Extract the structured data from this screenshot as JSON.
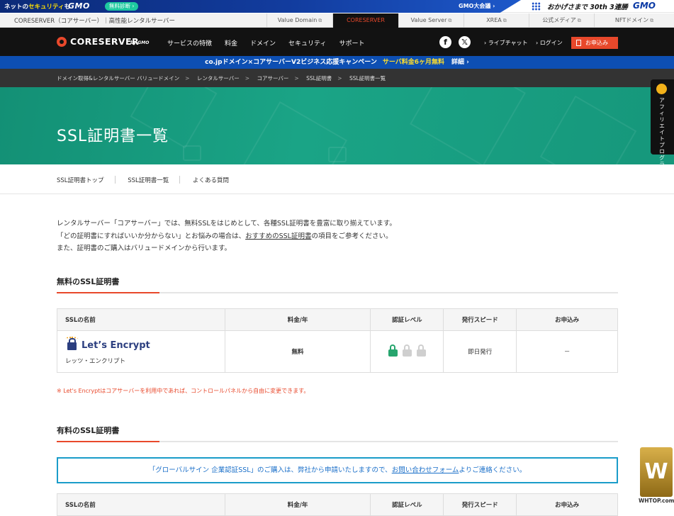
{
  "gmo_banner": {
    "text_prefix": "ネットの",
    "text_highlight": "セキュリティ",
    "text_suffix": "も",
    "logo": "GMO",
    "diagnosis_button": "無料診断 ›",
    "meeting_link": "GMO大会議 ›",
    "okage": "おかげさまで 30th 3連勝",
    "logo_right": "GMO"
  },
  "service_nav": {
    "brand": "CORESERVER（コアサーバー）｜高性能レンタルサーバー",
    "tabs": [
      {
        "label": "Value Domain",
        "ext": "⧉"
      },
      {
        "label": "CORESERVER",
        "ext": ""
      },
      {
        "label": "Value Server",
        "ext": "⧉"
      },
      {
        "label": "XREA",
        "ext": "⧉"
      },
      {
        "label": "公式メディア",
        "ext": "⧉"
      },
      {
        "label": "NFTドメイン",
        "ext": "⧉"
      }
    ]
  },
  "header": {
    "logo_text": "CORESERVER",
    "logo_by": "by GMO",
    "nav": [
      "サービスの特徴",
      "料金",
      "ドメイン",
      "セキュリティ",
      "サポート"
    ],
    "live_chat": "› ライブチャット",
    "login": "› ログイン",
    "apply": "お申込み"
  },
  "campaign": {
    "main": "co.jpドメイン×コアサーバーV2ビジネス応援キャンペーン",
    "highlight": "サーバ料金6ヶ月無料",
    "more": "詳細 ›"
  },
  "breadcrumb": [
    "ドメイン取得&レンタルサーバー バリュードメイン",
    "レンタルサーバー",
    "コアサーバー",
    "SSL証明書",
    "SSL証明書一覧"
  ],
  "hero": {
    "title": "SSL証明書一覧"
  },
  "affiliate": {
    "label": "アフィリエイトプログラム開始 ›"
  },
  "subnav": [
    "SSL証明書トップ",
    "SSL証明書一覧",
    "よくある質問"
  ],
  "intro": {
    "line1": "レンタルサーバー「コアサーバー」では、無料SSLをはじめとして、各種SSL証明書を豊富に取り揃えています。",
    "line2_pre": "「どの証明書にすればいいか分からない」とお悩みの場合は、",
    "line2_link": "おすすめのSSL証明書",
    "line2_post": "の項目をご参考ください。",
    "line3": "また、証明書のご購入はバリュードメインから行います。"
  },
  "free_section": {
    "title": "無料のSSL証明書",
    "headers": [
      "SSLの名前",
      "料金/年",
      "認証レベル",
      "発行スピード",
      "お申込み"
    ],
    "row": {
      "logo_text": "Let’s Encrypt",
      "kana": "レッツ・エンクリプト",
      "price": "無料",
      "auth_level": 1,
      "auth_max": 3,
      "speed": "即日発行",
      "apply": "－"
    },
    "note": "※ Let's Encryptはコアサーバーを利用中であれば、コントロールパネルから自由に変更できます。"
  },
  "paid_section": {
    "title": "有料のSSL証明書",
    "notice_pre": "「グローバルサイン 企業認証SSL」のご購入は、弊社から申請いたしますので、",
    "notice_link": "お問い合わせフォーム",
    "notice_post": "よりご連絡ください。",
    "headers": [
      "SSLの名前",
      "料金/年",
      "認証レベル",
      "発行スピード",
      "お申込み"
    ]
  },
  "watermark": {
    "text": "WHTOP.com",
    "badge": "W"
  },
  "colors": {
    "accent": "#e8482b",
    "hero": "#17987c",
    "campaign": "#0d4fb3",
    "lock_on": "#27a56e",
    "lock_off": "#cfcfcf"
  }
}
